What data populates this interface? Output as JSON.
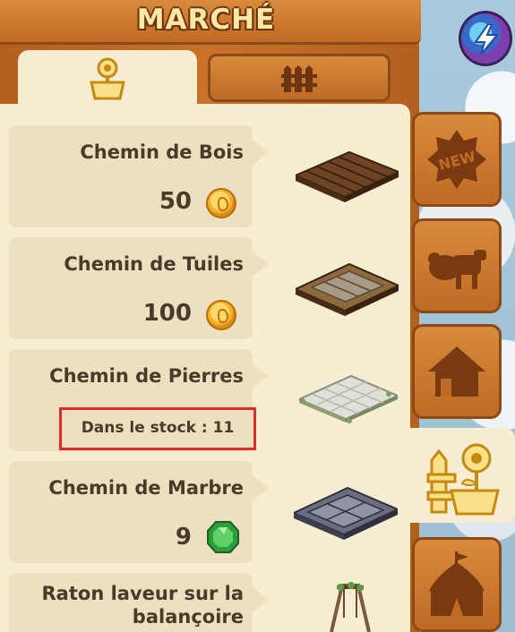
{
  "window": {
    "title": "MARCHÉ"
  },
  "top_tabs": [
    {
      "name": "decoration",
      "icon": "flower-pot-icon",
      "active": true
    },
    {
      "name": "fences",
      "icon": "fence-icon",
      "active": false
    }
  ],
  "side_tabs": [
    {
      "icon": "new-badge-icon",
      "label": "NEW",
      "active": false
    },
    {
      "icon": "animals-icon",
      "active": false
    },
    {
      "icon": "house-icon",
      "active": false
    },
    {
      "icon": "flower-pot-fence-icon",
      "active": true
    },
    {
      "icon": "tent-icon",
      "active": false
    }
  ],
  "items": [
    {
      "name": "Chemin de Bois",
      "price": "50",
      "currency": "coin-icon"
    },
    {
      "name": "Chemin de Tuiles",
      "price": "100",
      "currency": "coin-icon"
    },
    {
      "name": "Chemin de Pierres",
      "stock": "Dans le stock : 11"
    },
    {
      "name": "Chemin de Marbre",
      "price": "9",
      "currency": "gem-icon"
    },
    {
      "name": "Raton laveur sur la balançoire"
    }
  ],
  "colors": {
    "wood": "#c06b25",
    "panel": "#f6edd3",
    "card": "#ece0c0",
    "text": "#4a3a2a",
    "highlight": "#e02a2a"
  }
}
